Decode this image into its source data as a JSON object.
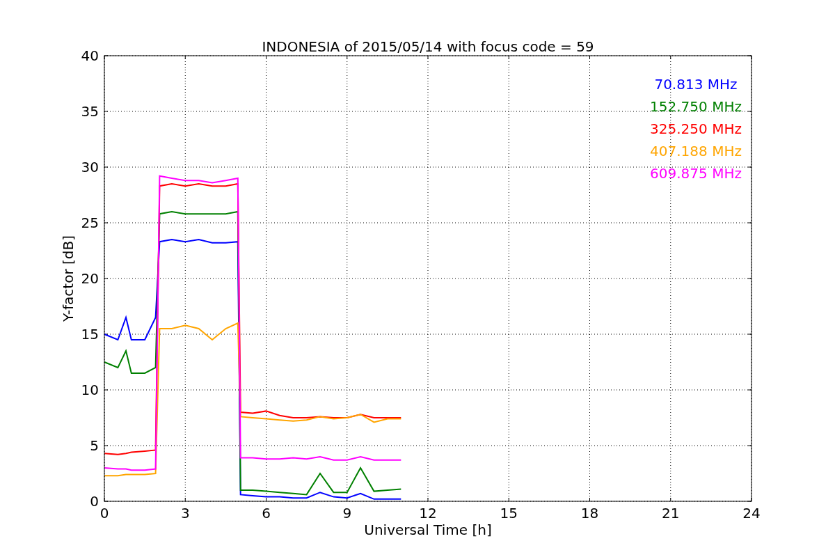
{
  "chart_data": {
    "type": "line",
    "title": "INDONESIA of 2015/05/14 with focus code = 59",
    "xlabel": "Universal Time [h]",
    "ylabel": "Y-factor [dB]",
    "x": [
      0,
      0.5,
      0.8,
      1,
      1.5,
      1.9,
      2.05,
      2.5,
      3,
      3.5,
      4,
      4.5,
      4.95,
      5.05,
      5.5,
      6,
      6.5,
      7,
      7.5,
      8,
      8.5,
      9,
      9.5,
      10,
      10.5,
      11
    ],
    "series": [
      {
        "name": "70.813 MHz",
        "color": "#0000ff",
        "values": [
          15,
          14.5,
          16.5,
          14.5,
          14.5,
          16.5,
          23.3,
          23.5,
          23.3,
          23.5,
          23.2,
          23.2,
          23.3,
          0.6,
          0.5,
          0.4,
          0.4,
          0.3,
          0.3,
          0.8,
          0.4,
          0.3,
          0.7,
          0.2,
          0.2,
          0.2
        ]
      },
      {
        "name": "152.750 MHz",
        "color": "#008000",
        "values": [
          12.5,
          12,
          13.5,
          11.5,
          11.5,
          12,
          25.8,
          26,
          25.8,
          25.8,
          25.8,
          25.8,
          26,
          1,
          1,
          0.9,
          0.8,
          0.7,
          0.6,
          2.5,
          0.8,
          0.8,
          3,
          0.9,
          1,
          1.1
        ]
      },
      {
        "name": "325.250 MHz",
        "color": "#ff0000",
        "values": [
          4.3,
          4.2,
          4.3,
          4.4,
          4.5,
          4.6,
          28.3,
          28.5,
          28.3,
          28.5,
          28.3,
          28.3,
          28.5,
          8,
          7.9,
          8.1,
          7.7,
          7.5,
          7.5,
          7.6,
          7.5,
          7.5,
          7.8,
          7.5,
          7.5,
          7.5
        ]
      },
      {
        "name": "407.188 MHz",
        "color": "#ffa500",
        "values": [
          2.3,
          2.3,
          2.4,
          2.4,
          2.4,
          2.5,
          15.5,
          15.5,
          15.8,
          15.5,
          14.5,
          15.5,
          16,
          7.6,
          7.5,
          7.4,
          7.3,
          7.2,
          7.3,
          7.6,
          7.4,
          7.5,
          7.8,
          7.1,
          7.4,
          7.4
        ]
      },
      {
        "name": "609.875 MHz",
        "color": "#ff00ff",
        "values": [
          3,
          2.9,
          2.9,
          2.8,
          2.8,
          2.9,
          29.2,
          29,
          28.8,
          28.8,
          28.6,
          28.8,
          29,
          3.9,
          3.9,
          3.8,
          3.8,
          3.9,
          3.8,
          4,
          3.7,
          3.7,
          4,
          3.7,
          3.7,
          3.7
        ]
      }
    ],
    "grid": true,
    "xlim": [
      0,
      24
    ],
    "ylim": [
      0,
      40
    ],
    "xticks": [
      0,
      3,
      6,
      9,
      12,
      15,
      18,
      21,
      24
    ],
    "yticks": [
      0,
      5,
      10,
      15,
      20,
      25,
      30,
      35,
      40
    ]
  }
}
